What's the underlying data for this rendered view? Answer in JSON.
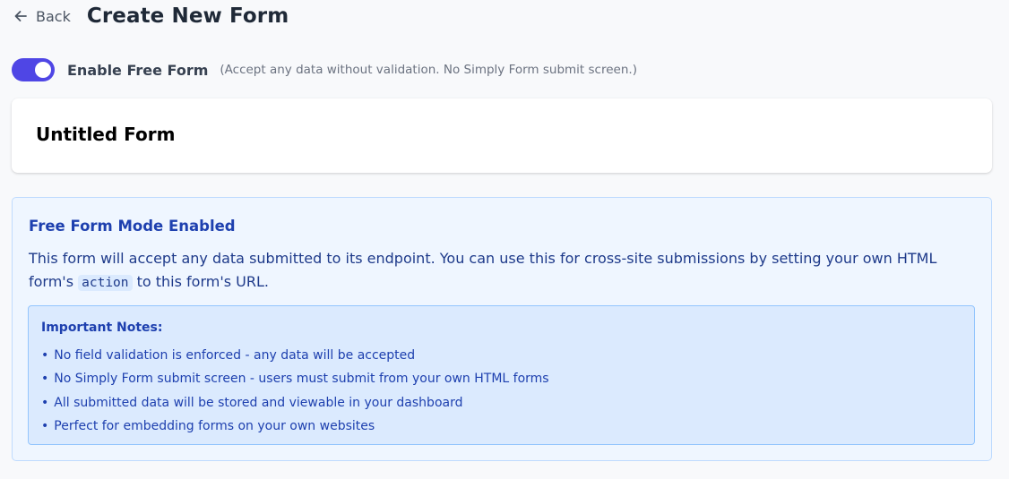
{
  "header": {
    "back_label": "Back",
    "title": "Create New Form"
  },
  "free_form": {
    "enabled": true,
    "label": "Enable Free Form",
    "hint": "(Accept any data without validation. No Simply Form submit screen.)"
  },
  "form": {
    "title_value": "Untitled Form"
  },
  "info": {
    "title": "Free Form Mode Enabled",
    "desc_part1": "This form will accept any data submitted to its endpoint. You can use this for cross-site submissions by setting your own HTML form's ",
    "code": "action",
    "desc_part2": " to this form's URL.",
    "notes_title": "Important Notes:",
    "notes": [
      "No field validation is enforced - any data will be accepted",
      "No Simply Form submit screen - users must submit from your own HTML forms",
      "All submitted data will be stored and viewable in your dashboard",
      "Perfect for embedding forms on your own websites"
    ]
  },
  "colors": {
    "accent": "#4f46e5",
    "info_bg": "#eff6ff",
    "info_text": "#1e40af",
    "notes_bg": "#dbeafe"
  },
  "icons": {
    "back": "arrow-left-icon"
  }
}
